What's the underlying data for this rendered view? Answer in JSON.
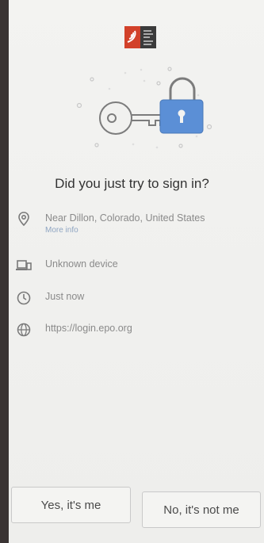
{
  "prompt": {
    "title": "Did you just try to sign in?"
  },
  "details": [
    {
      "icon": "location-pin-icon",
      "text": "Near Dillon, Colorado, United States",
      "link": "More info"
    },
    {
      "icon": "device-icon",
      "text": "Unknown device"
    },
    {
      "icon": "clock-icon",
      "text": "Just now"
    },
    {
      "icon": "globe-icon",
      "text": "https://login.epo.org"
    }
  ],
  "actions": {
    "confirm_label": "Yes, it's me",
    "deny_label": "No, it's not me"
  },
  "colors": {
    "accent": "#5b8fd6",
    "logo_red": "#d2412a"
  }
}
